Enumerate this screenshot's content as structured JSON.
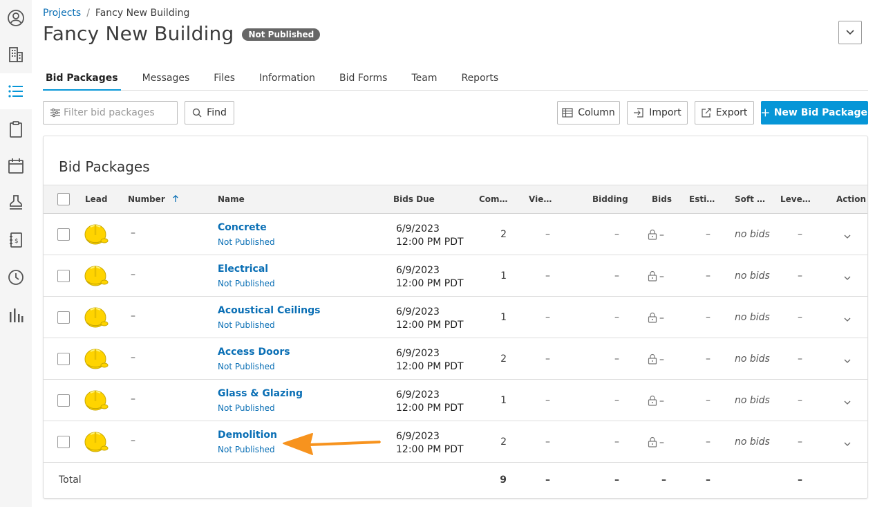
{
  "rail": {
    "items": [
      {
        "icon": "user-circle-icon"
      },
      {
        "icon": "building-icon"
      },
      {
        "icon": "list-icon",
        "active": true
      },
      {
        "icon": "clipboard-icon"
      },
      {
        "icon": "calendar-icon"
      },
      {
        "icon": "stamp-icon"
      },
      {
        "icon": "address-book-icon"
      },
      {
        "icon": "clock-icon"
      },
      {
        "icon": "bar-chart-icon"
      }
    ]
  },
  "breadcrumb": {
    "root": "Projects",
    "separator": "/",
    "current": "Fancy New Building"
  },
  "header": {
    "title": "Fancy New Building",
    "badge": "Not Published"
  },
  "tabs": [
    {
      "label": "Bid Packages",
      "active": true
    },
    {
      "label": "Messages"
    },
    {
      "label": "Files"
    },
    {
      "label": "Information"
    },
    {
      "label": "Bid Forms"
    },
    {
      "label": "Team"
    },
    {
      "label": "Reports"
    }
  ],
  "toolbar": {
    "filter_placeholder": "Filter bid packages",
    "find_label": "Find",
    "column_label": "Column",
    "import_label": "Import",
    "export_label": "Export",
    "new_label": "New Bid Package"
  },
  "card": {
    "title": "Bid Packages"
  },
  "columns": {
    "lead": "Lead",
    "number": "Number",
    "name": "Name",
    "bids_due": "Bids Due",
    "com": "Com…",
    "vie": "Vie…",
    "bidding": "Bidding",
    "bids": "Bids",
    "esti": "Esti…",
    "soft": "Soft …",
    "leve": "Leve…",
    "action": "Action"
  },
  "rows": [
    {
      "number": "–",
      "name": "Concrete",
      "status": "Not Published",
      "date": "6/9/2023",
      "time": "12:00 PM PDT",
      "com": "2",
      "vie": "–",
      "bidding": "–",
      "bids": "–",
      "esti": "–",
      "soft": "no bids",
      "leve": "–"
    },
    {
      "number": "–",
      "name": "Electrical",
      "status": "Not Published",
      "date": "6/9/2023",
      "time": "12:00 PM PDT",
      "com": "1",
      "vie": "–",
      "bidding": "–",
      "bids": "–",
      "esti": "–",
      "soft": "no bids",
      "leve": "–"
    },
    {
      "number": "–",
      "name": "Acoustical Ceilings",
      "status": "Not Published",
      "date": "6/9/2023",
      "time": "12:00 PM PDT",
      "com": "1",
      "vie": "–",
      "bidding": "–",
      "bids": "–",
      "esti": "–",
      "soft": "no bids",
      "leve": "–"
    },
    {
      "number": "–",
      "name": "Access Doors",
      "status": "Not Published",
      "date": "6/9/2023",
      "time": "12:00 PM PDT",
      "com": "2",
      "vie": "–",
      "bidding": "–",
      "bids": "–",
      "esti": "–",
      "soft": "no bids",
      "leve": "–"
    },
    {
      "number": "–",
      "name": "Glass & Glazing",
      "status": "Not Published",
      "date": "6/9/2023",
      "time": "12:00 PM PDT",
      "com": "1",
      "vie": "–",
      "bidding": "–",
      "bids": "–",
      "esti": "–",
      "soft": "no bids",
      "leve": "–"
    },
    {
      "number": "–",
      "name": "Demolition",
      "status": "Not Published",
      "date": "6/9/2023",
      "time": "12:00 PM PDT",
      "com": "2",
      "vie": "–",
      "bidding": "–",
      "bids": "–",
      "esti": "–",
      "soft": "no bids",
      "leve": "–"
    }
  ],
  "total": {
    "label": "Total",
    "com": "9",
    "vie": "–",
    "bidding": "–",
    "bids": "–",
    "esti": "–",
    "leve": "–"
  },
  "colors": {
    "accent": "#0696d7",
    "link": "#0a6fb5",
    "badge": "#666666",
    "annotation_arrow": "#f7931e",
    "helmet": "#ffd400"
  }
}
